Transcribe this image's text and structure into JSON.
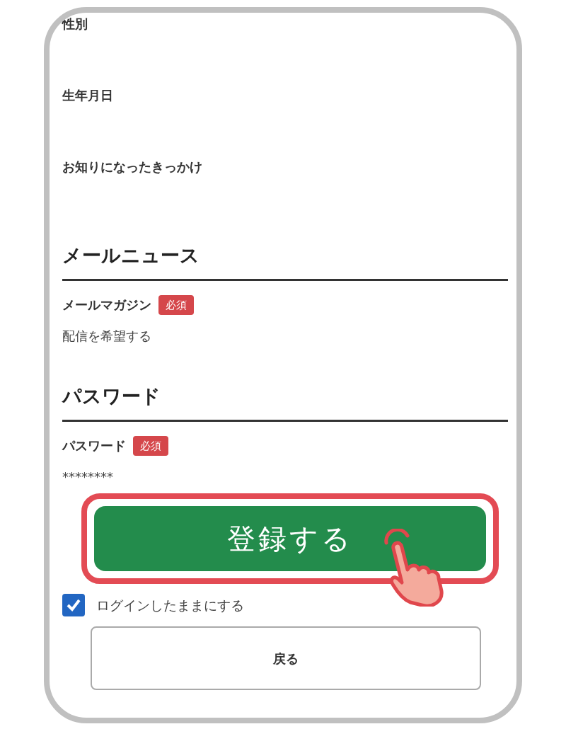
{
  "fields_top": [
    {
      "label": "性別"
    },
    {
      "label": "生年月日"
    },
    {
      "label": "お知りになったきっかけ"
    }
  ],
  "sections": [
    {
      "heading": "メールニュース",
      "fields": [
        {
          "label": "メールマガジン",
          "required_badge": "必須",
          "value": "配信を希望する"
        }
      ]
    },
    {
      "heading": "パスワード",
      "fields": [
        {
          "label": "パスワード",
          "required_badge": "必須",
          "value": "********"
        }
      ]
    }
  ],
  "submit_button": {
    "label": "登録する",
    "highlighted": true
  },
  "keep_login": {
    "label": "ログインしたままにする",
    "checked": true
  },
  "back_button": {
    "label": "戻る"
  }
}
